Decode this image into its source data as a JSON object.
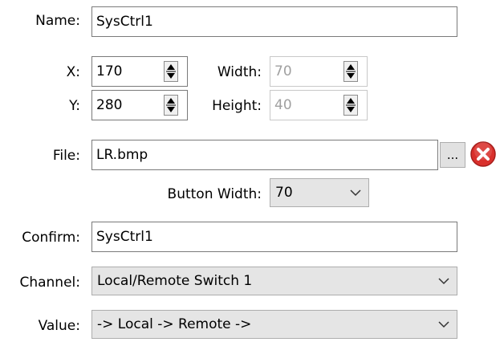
{
  "name": {
    "label": "Name:",
    "value": "SysCtrl1"
  },
  "x": {
    "label": "X:",
    "value": "170"
  },
  "y": {
    "label": "Y:",
    "value": "280"
  },
  "width": {
    "label": "Width:",
    "value": "70"
  },
  "height": {
    "label": "Height:",
    "value": "40"
  },
  "file": {
    "label": "File:",
    "value": "LR.bmp",
    "browse_label": "..."
  },
  "button_width": {
    "label": "Button Width:",
    "value": "70"
  },
  "confirm": {
    "label": "Confirm:",
    "value": "SysCtrl1"
  },
  "channel": {
    "label": "Channel:",
    "value": "Local/Remote Switch 1"
  },
  "value": {
    "label": "Value:",
    "value": "-> Local -> Remote ->"
  },
  "icons": {
    "spin": "up-down-arrows-icon",
    "dropdown": "chevron-down-icon",
    "clear": "red-x-clear-icon"
  },
  "colors": {
    "clear_icon": "#d9302c",
    "combo_bg": "#e5e5e5",
    "disabled_text": "#a0a0a0"
  }
}
